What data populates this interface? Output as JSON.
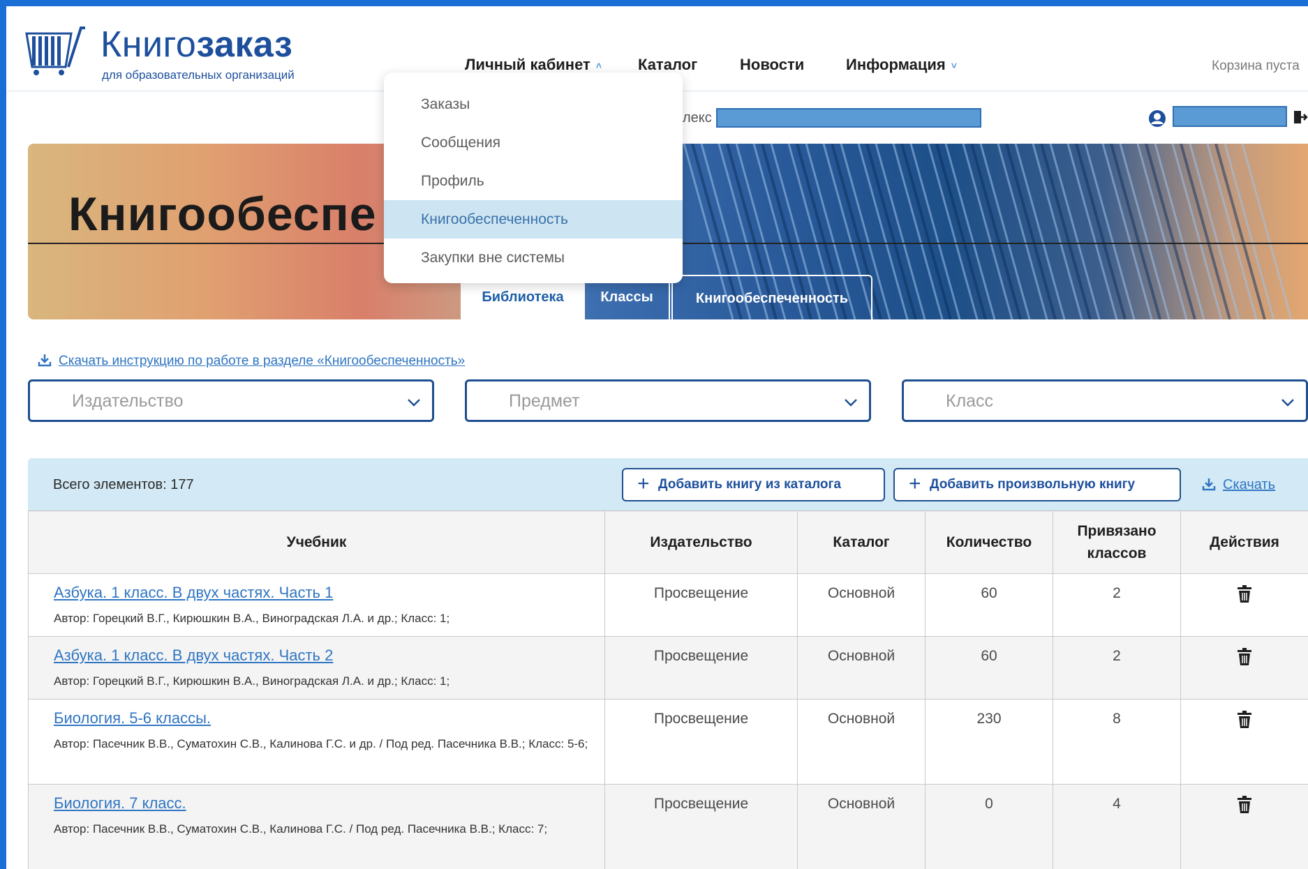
{
  "header": {
    "logo_title_light": "Книго",
    "logo_title_bold": "заказ",
    "logo_subtitle": "для образовательных организаций",
    "nav": {
      "cabinet": "Личный кабинет",
      "catalog": "Каталог",
      "news": "Новости",
      "info": "Информация"
    },
    "cart_status": "Корзина пуста"
  },
  "account_row": {
    "complex_label": "лекс"
  },
  "dropdown": {
    "items": [
      "Заказы",
      "Сообщения",
      "Профиль",
      "Книгообеспеченность",
      "Закупки вне системы"
    ],
    "active_index": 3
  },
  "banner": {
    "title": "Книгообеспе",
    "tabs": [
      "Библиотека",
      "Классы",
      "Книгообеспеченность"
    ]
  },
  "instruction_link": "Скачать инструкцию по работе в разделе «Книгообеспеченность»",
  "filters": {
    "publisher_placeholder": "Издательство",
    "subject_placeholder": "Предмет",
    "grade_placeholder": "Класс"
  },
  "toolbar": {
    "total": "Всего элементов: 177",
    "add_from_catalog": "Добавить книгу из каталога",
    "add_custom": "Добавить произвольную книгу",
    "download": "Скачать"
  },
  "table": {
    "headers": {
      "book": "Учебник",
      "publisher": "Издательство",
      "catalog": "Каталог",
      "quantity": "Количество",
      "linked_line1": "Привязано",
      "linked_line2": "классов",
      "actions": "Действия"
    },
    "rows": [
      {
        "title": "Азбука. 1 класс. В двух частях. Часть 1",
        "meta": "Автор: Горецкий В.Г., Кирюшкин В.А., Виноградская Л.А. и др.; Класс: 1;",
        "publisher": "Просвещение",
        "catalog": "Основной",
        "quantity": "60",
        "linked": "2"
      },
      {
        "title": "Азбука. 1 класс. В двух частях. Часть 2",
        "meta": "Автор: Горецкий В.Г., Кирюшкин В.А., Виноградская Л.А. и др.; Класс: 1;",
        "publisher": "Просвещение",
        "catalog": "Основной",
        "quantity": "60",
        "linked": "2"
      },
      {
        "title": "Биология. 5-6 классы.",
        "meta": "Автор: Пасечник В.В., Суматохин С.В., Калинова Г.С. и др. / Под ред. Пасечника В.В.; Класс: 5-6;",
        "publisher": "Просвещение",
        "catalog": "Основной",
        "quantity": "230",
        "linked": "8"
      },
      {
        "title": "Биология. 7 класс.",
        "meta": "Автор: Пасечник В.В., Суматохин С.В., Калинова Г.С. / Под ред. Пасечника В.В.; Класс: 7;",
        "publisher": "Просвещение",
        "catalog": "Основной",
        "quantity": "0",
        "linked": "4"
      }
    ]
  },
  "colors": {
    "brand": "#1d4f9c",
    "link": "#2f75c2",
    "toolbar_bg": "#d3eaf6",
    "active_menu_bg": "#cde4f3"
  }
}
